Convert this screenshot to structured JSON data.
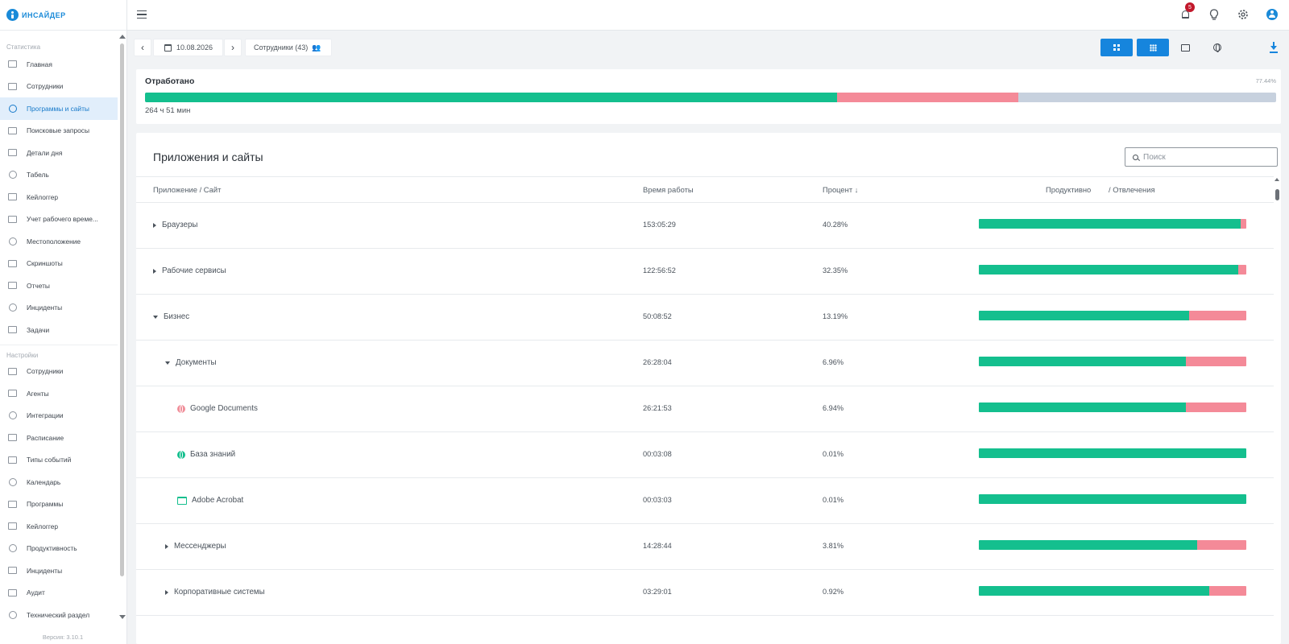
{
  "app": {
    "logo_text": "ИНСАЙДЕР",
    "version": "Версия: 3.10.1"
  },
  "colors": {
    "accent": "#1685dd",
    "productive": "#14bf8e",
    "distraction": "#f48a98",
    "idle": "#c7d1de",
    "badge": "#c2182b"
  },
  "header": {
    "notifications_count": "5",
    "icons": [
      "menu-icon",
      "bell-icon",
      "lightbulb-icon",
      "gear-icon",
      "user-icon"
    ]
  },
  "sidebar": {
    "section_stats": "Статистика",
    "stats_items": [
      {
        "label": "Главная",
        "icon": "dashboard-icon"
      },
      {
        "label": "Сотрудники",
        "icon": "people-icon"
      },
      {
        "label": "Программы и сайты",
        "icon": "window-icon",
        "active": true
      },
      {
        "label": "Поисковые запросы",
        "icon": "search-icon"
      },
      {
        "label": "Детали дня",
        "icon": "chart-line-icon"
      },
      {
        "label": "Табель",
        "icon": "document-icon"
      },
      {
        "label": "Кейлоггер",
        "icon": "keyboard-icon"
      },
      {
        "label": "Учет рабочего време...",
        "icon": "clock-document-icon"
      },
      {
        "label": "Местоположение",
        "icon": "location-icon"
      },
      {
        "label": "Скриншоты",
        "icon": "monitor-icon"
      },
      {
        "label": "Отчеты",
        "icon": "report-icon"
      },
      {
        "label": "Инциденты",
        "icon": "alert-icon"
      },
      {
        "label": "Задачи",
        "icon": "check-circle-icon"
      }
    ],
    "section_settings": "Настройки",
    "settings_items": [
      {
        "label": "Сотрудники",
        "icon": "user-settings-icon"
      },
      {
        "label": "Агенты",
        "icon": "agents-icon"
      },
      {
        "label": "Интеграции",
        "icon": "integrations-icon"
      },
      {
        "label": "Расписание",
        "icon": "schedule-icon"
      },
      {
        "label": "Типы событий",
        "icon": "event-types-icon"
      },
      {
        "label": "Календарь",
        "icon": "calendar-icon"
      },
      {
        "label": "Программы",
        "icon": "programs-icon"
      },
      {
        "label": "Кейлоггер",
        "icon": "keyboard-icon"
      },
      {
        "label": "Продуктивность",
        "icon": "lightning-icon"
      },
      {
        "label": "Инциденты",
        "icon": "alert-icon"
      },
      {
        "label": "Аудит",
        "icon": "audit-icon"
      },
      {
        "label": "Технический раздел",
        "icon": "gear-icon"
      }
    ]
  },
  "toolbar": {
    "date": "10.08.2026",
    "employees_label": "Сотрудники (43)",
    "view_buttons": [
      "grid-view-icon",
      "grid9-view-icon",
      "window-view-icon",
      "globe-view-icon"
    ],
    "selected_views": [
      0,
      1
    ]
  },
  "worked": {
    "title": "Отработано",
    "percent": "77.44%",
    "hours": "264 ч 51 мин",
    "productive_fraction": 0.612,
    "distraction_fraction": 0.16
  },
  "apps": {
    "title": "Приложения и сайты",
    "search_placeholder": "Поиск",
    "columns": {
      "name": "Приложение / Сайт",
      "time": "Время работы",
      "percent": "Процент ↓",
      "productive": "Продуктивно",
      "distraction": "/ Отвлечения"
    },
    "rows": [
      {
        "name": "Браузеры",
        "time": "153:05:29",
        "percent": "40.28%",
        "level": 0,
        "expander": "collapsed",
        "productive_ratio": 0.98
      },
      {
        "name": "Рабочие сервисы",
        "time": "122:56:52",
        "percent": "32.35%",
        "level": 0,
        "expander": "collapsed",
        "productive_ratio": 0.97
      },
      {
        "name": "Бизнес",
        "time": "50:08:52",
        "percent": "13.19%",
        "level": 0,
        "expander": "expanded",
        "productive_ratio": 0.785
      },
      {
        "name": "Документы",
        "time": "26:28:04",
        "percent": "6.96%",
        "level": 1,
        "expander": "expanded",
        "productive_ratio": 0.775
      },
      {
        "name": "Google Documents",
        "time": "26:21:53",
        "percent": "6.94%",
        "level": 2,
        "icon": "globe-red",
        "productive_ratio": 0.775
      },
      {
        "name": "База знаний",
        "time": "00:03:08",
        "percent": "0.01%",
        "level": 2,
        "icon": "globe-green",
        "productive_ratio": 1
      },
      {
        "name": "Adobe Acrobat",
        "time": "00:03:03",
        "percent": "0.01%",
        "level": 2,
        "icon": "window-green",
        "productive_ratio": 1
      },
      {
        "name": "Мессенджеры",
        "time": "14:28:44",
        "percent": "3.81%",
        "level": 1,
        "expander": "collapsed",
        "productive_ratio": 0.815
      },
      {
        "name": "Корпоративные системы",
        "time": "03:29:01",
        "percent": "0.92%",
        "level": 1,
        "expander": "collapsed",
        "productive_ratio": 0.86
      }
    ]
  }
}
